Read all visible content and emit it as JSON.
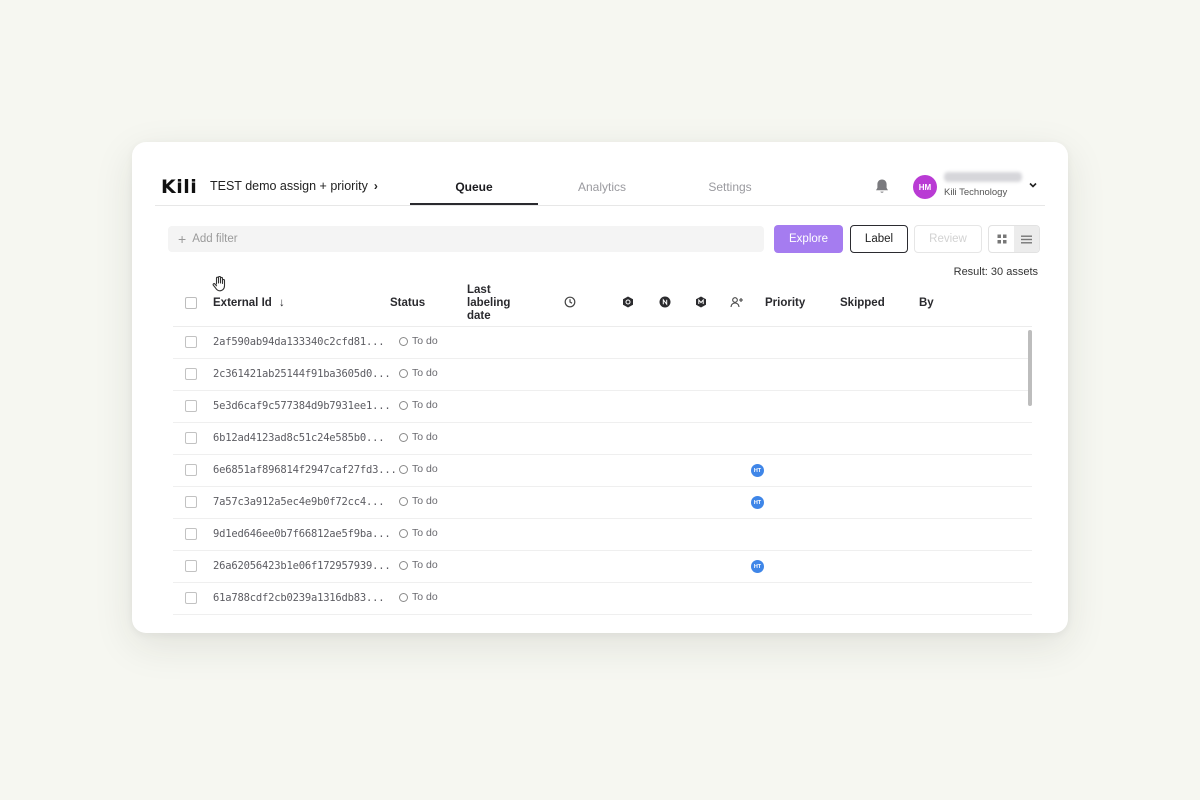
{
  "header": {
    "logo": "Kili",
    "project": "TEST demo assign + priority",
    "tabs": [
      {
        "label": "Queue",
        "active": true
      },
      {
        "label": "Analytics",
        "active": false
      },
      {
        "label": "Settings",
        "active": false
      }
    ],
    "user": {
      "initials": "HM",
      "organization": "Kili Technology",
      "avatar_color": "#b93bd4"
    }
  },
  "toolbar": {
    "filter_placeholder": "Add filter",
    "explore": "Explore",
    "label": "Label",
    "review": "Review",
    "accent": "#a57cf0"
  },
  "result": "Result: 30 assets",
  "table": {
    "columns": {
      "external_id": "External Id",
      "status": "Status",
      "last_labeling_date": "Last labeling date",
      "priority": "Priority",
      "skipped": "Skipped",
      "by": "By"
    },
    "rows": [
      {
        "id": "2af590ab94da133340c2cfd81...",
        "status": "To do",
        "assignee": ""
      },
      {
        "id": "2c361421ab25144f91ba3605d0...",
        "status": "To do",
        "assignee": ""
      },
      {
        "id": "5e3d6caf9c577384d9b7931ee1...",
        "status": "To do",
        "assignee": ""
      },
      {
        "id": "6b12ad4123ad8c51c24e585b0...",
        "status": "To do",
        "assignee": ""
      },
      {
        "id": "6e6851af896814f2947caf27fd3...",
        "status": "To do",
        "assignee": "HT"
      },
      {
        "id": "7a57c3a912a5ec4e9b0f72cc4...",
        "status": "To do",
        "assignee": "HT"
      },
      {
        "id": "9d1ed646ee0b7f66812ae5f9ba...",
        "status": "To do",
        "assignee": ""
      },
      {
        "id": "26a62056423b1e06f172957939...",
        "status": "To do",
        "assignee": "HT"
      },
      {
        "id": "61a788cdf2cb0239a1316db83...",
        "status": "To do",
        "assignee": ""
      }
    ]
  }
}
